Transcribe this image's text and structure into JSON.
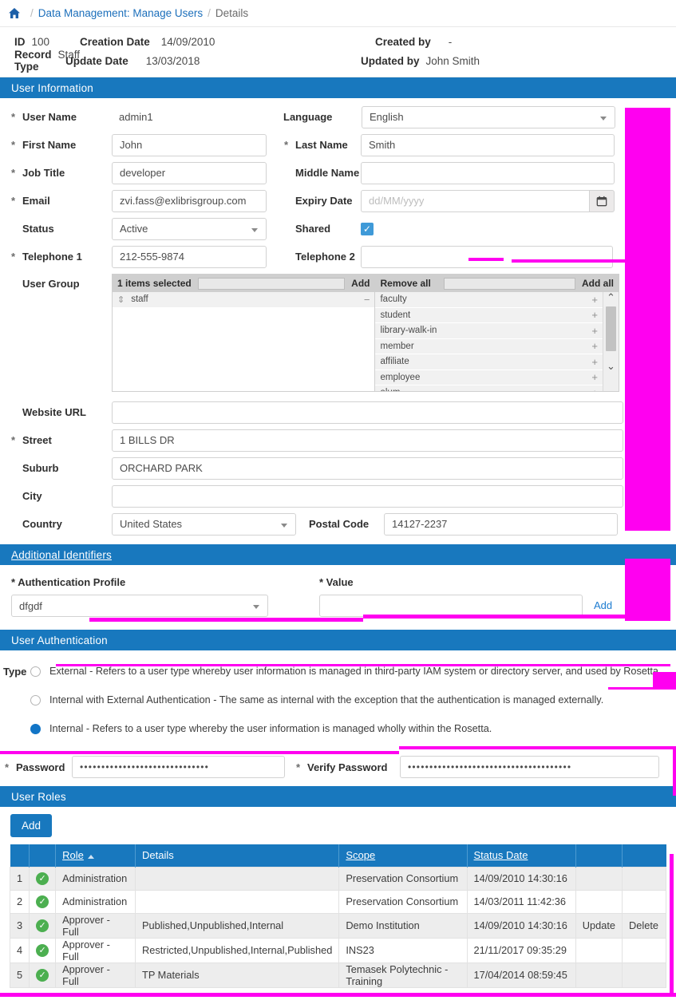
{
  "breadcrumb": {
    "home_icon": "home-icon",
    "sep": "/",
    "link": "Data Management: Manage Users",
    "current": "Details"
  },
  "meta": {
    "id_label": "ID",
    "id_value": "100",
    "record_type_label": "Record Type",
    "record_type_value": "Staff",
    "creation_date_label": "Creation Date",
    "creation_date_value": "14/09/2010",
    "update_date_label": "Update Date",
    "update_date_value": "13/03/2018",
    "created_by_label": "Created by",
    "created_by_value": "-",
    "updated_by_label": "Updated by",
    "updated_by_value": "John Smith"
  },
  "sections": {
    "user_information": "User Information",
    "additional_identifiers": "Additional Identifiers",
    "user_authentication": "User Authentication",
    "user_roles": "User Roles"
  },
  "user_info": {
    "user_name_label": "User Name",
    "user_name_value": "admin1",
    "language_label": "Language",
    "language_value": "English",
    "first_name_label": "First Name",
    "first_name_value": "John",
    "last_name_label": "Last Name",
    "last_name_value": "Smith",
    "job_title_label": "Job Title",
    "job_title_value": "developer",
    "middle_name_label": "Middle Name",
    "middle_name_value": "",
    "email_label": "Email",
    "email_value": "zvi.fass@exlibrisgroup.com",
    "expiry_date_label": "Expiry Date",
    "expiry_date_value": "",
    "expiry_date_placeholder": "dd/MM/yyyy",
    "calendar_icon": "calendar-icon",
    "status_label": "Status",
    "status_value": "Active",
    "shared_label": "Shared",
    "shared_checked": "✓",
    "telephone1_label": "Telephone 1",
    "telephone1_value": "212-555-9874",
    "telephone2_label": "Telephone 2",
    "telephone2_value": "",
    "user_group_label": "User Group",
    "website_url_label": "Website URL",
    "website_url_value": "",
    "street_label": "Street",
    "street_value": "1 BILLS DR",
    "suburb_label": "Suburb",
    "suburb_value": "ORCHARD PARK",
    "city_label": "City",
    "city_value": "",
    "country_label": "Country",
    "country_value": "United States",
    "postal_code_label": "Postal Code",
    "postal_code_value": "14127-2237"
  },
  "user_group": {
    "selected_count": "1 items selected",
    "filter_left_value": "",
    "add_label": "Add",
    "remove_all_label": "Remove all",
    "filter_right_value": "",
    "add_all_label": "Add all",
    "selected_items": [
      {
        "label": "staff",
        "grip": "drag-handle-icon",
        "action": "−"
      }
    ],
    "available_items": [
      {
        "label": "faculty",
        "action": "+"
      },
      {
        "label": "student",
        "action": "+"
      },
      {
        "label": "library-walk-in",
        "action": "+"
      },
      {
        "label": "member",
        "action": "+"
      },
      {
        "label": "affiliate",
        "action": "+"
      },
      {
        "label": "employee",
        "action": "+"
      },
      {
        "label": "alum",
        "action": "+"
      }
    ]
  },
  "additional_identifiers": {
    "auth_profile_label": "* Authentication Profile",
    "auth_profile_value": "dfgdf",
    "value_label": "* Value",
    "value_value": "",
    "add_link": "Add"
  },
  "user_authentication": {
    "type_label": "Type",
    "options": [
      {
        "text": "External - Refers to a user type whereby user information is managed in third-party IAM system or directory server, and used by Rosetta.",
        "selected": false
      },
      {
        "text": "Internal with External Authentication - The same as internal with the exception that the authentication is managed externally.",
        "selected": false
      },
      {
        "text": "Internal - Refers to a user type whereby the user information is managed wholly within the Rosetta.",
        "selected": true
      }
    ],
    "password_label": "Password",
    "password_value": "••••••••••••••••••••••••••••••",
    "verify_password_label": "Verify Password",
    "verify_password_value": "••••••••••••••••••••••••••••••••••••••"
  },
  "user_roles": {
    "add_button": "Add",
    "columns": [
      "",
      "",
      "Role",
      "Details",
      "Scope",
      "Status Date",
      "",
      ""
    ],
    "sort_column": "Role",
    "sort_dir": "asc",
    "rows": [
      {
        "num": "1",
        "status": "active-check-icon",
        "role": "Administration",
        "details": "",
        "scope": "Preservation Consortium",
        "status_date": "14/09/2010 14:30:16",
        "update": "",
        "delete": ""
      },
      {
        "num": "2",
        "status": "active-check-icon",
        "role": "Administration",
        "details": "",
        "scope": "Preservation Consortium",
        "status_date": "14/03/2011 11:42:36",
        "update": "",
        "delete": ""
      },
      {
        "num": "3",
        "status": "active-check-icon",
        "role": "Approver - Full",
        "details": "Published,Unpublished,Internal",
        "scope": "Demo Institution",
        "status_date": "14/09/2010 14:30:16",
        "update": "Update",
        "delete": "Delete"
      },
      {
        "num": "4",
        "status": "active-check-icon",
        "role": "Approver - Full",
        "details": "Restricted,Unpublished,Internal,Published",
        "scope": "INS23",
        "status_date": "21/11/2017 09:35:29",
        "update": "",
        "delete": ""
      },
      {
        "num": "5",
        "status": "active-check-icon",
        "role": "Approver - Full",
        "details": "TP Materials",
        "scope": "Temasek Polytechnic - Training",
        "status_date": "17/04/2014 08:59:45",
        "update": "",
        "delete": ""
      }
    ]
  },
  "colors": {
    "section_blue": "#1878BE",
    "link_blue": "#1c7bd0",
    "highlight_magenta": "#ff00f0",
    "status_green": "#4caf50"
  }
}
